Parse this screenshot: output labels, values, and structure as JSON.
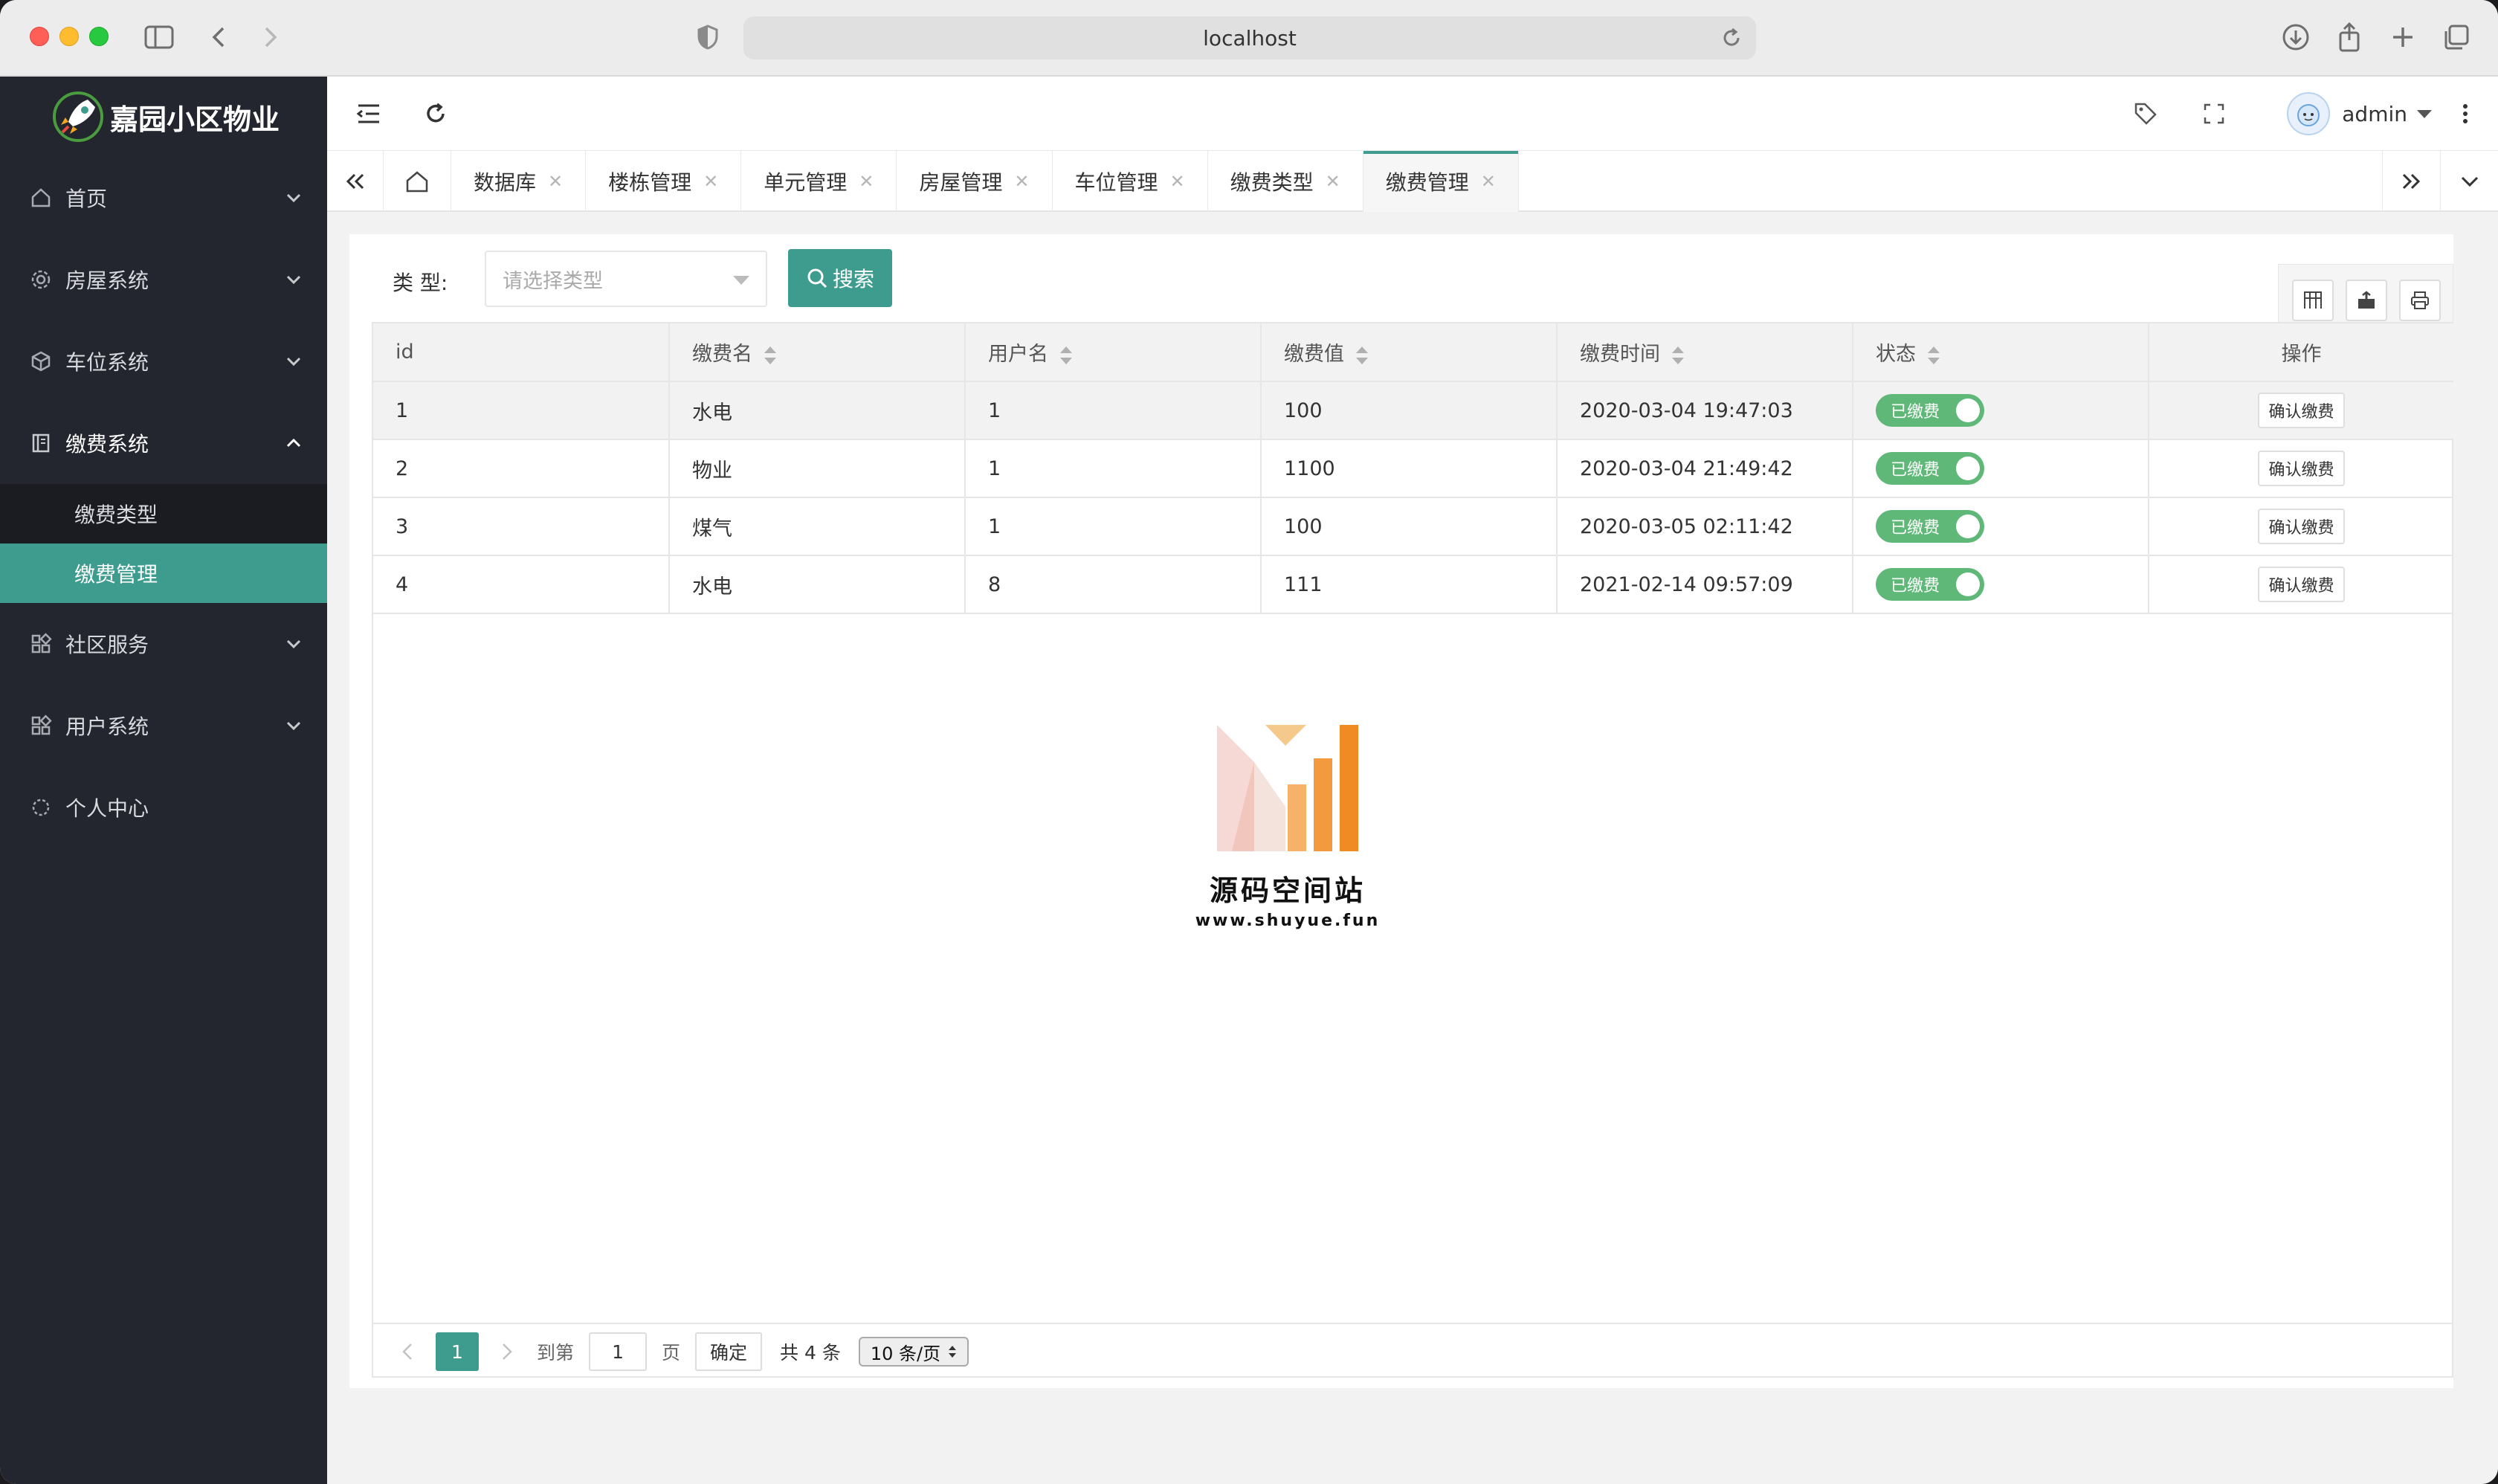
{
  "browser": {
    "address": "localhost"
  },
  "app": {
    "brand": "嘉园小区物业"
  },
  "sidebar": {
    "items": [
      {
        "label": "首页",
        "icon": "home-icon"
      },
      {
        "label": "房屋系统",
        "icon": "gear-icon"
      },
      {
        "label": "车位系统",
        "icon": "cube-icon"
      },
      {
        "label": "缴费系统",
        "icon": "book-icon"
      },
      {
        "label": "社区服务",
        "icon": "apps-icon"
      },
      {
        "label": "用户系统",
        "icon": "apps-icon"
      },
      {
        "label": "个人中心",
        "icon": "spin-icon"
      }
    ],
    "sub_items": [
      {
        "label": "缴费类型",
        "active": false
      },
      {
        "label": "缴费管理",
        "active": true
      }
    ]
  },
  "header": {
    "user": "admin"
  },
  "tabs": [
    {
      "label": "数据库"
    },
    {
      "label": "楼栋管理"
    },
    {
      "label": "单元管理"
    },
    {
      "label": "房屋管理"
    },
    {
      "label": "车位管理"
    },
    {
      "label": "缴费类型"
    },
    {
      "label": "缴费管理",
      "active": true
    }
  ],
  "filter": {
    "label": "类 型:",
    "placeholder": "请选择类型",
    "search_label": "搜索"
  },
  "table": {
    "columns": [
      "id",
      "缴费名",
      "用户名",
      "缴费值",
      "缴费时间",
      "状态",
      "操作"
    ],
    "rows": [
      {
        "id": "1",
        "name": "水电",
        "user": "1",
        "value": "100",
        "time": "2020-03-04 19:47:03",
        "status": "已缴费",
        "action": "确认缴费"
      },
      {
        "id": "2",
        "name": "物业",
        "user": "1",
        "value": "1100",
        "time": "2020-03-04 21:49:42",
        "status": "已缴费",
        "action": "确认缴费"
      },
      {
        "id": "3",
        "name": "煤气",
        "user": "1",
        "value": "100",
        "time": "2020-03-05 02:11:42",
        "status": "已缴费",
        "action": "确认缴费"
      },
      {
        "id": "4",
        "name": "水电",
        "user": "8",
        "value": "111",
        "time": "2021-02-14 09:57:09",
        "status": "已缴费",
        "action": "确认缴费"
      }
    ]
  },
  "watermark": {
    "title": "源码空间站",
    "url": "www.shuyue.fun"
  },
  "pager": {
    "current": "1",
    "goto_label": "到第",
    "goto_value": "1",
    "page_unit": "页",
    "ok_label": "确定",
    "total": "共 4 条",
    "page_size": "10 条/页"
  },
  "colors": {
    "accent": "#3e9c8f",
    "sidebar": "#23262e",
    "switch_on": "#5fb878"
  }
}
